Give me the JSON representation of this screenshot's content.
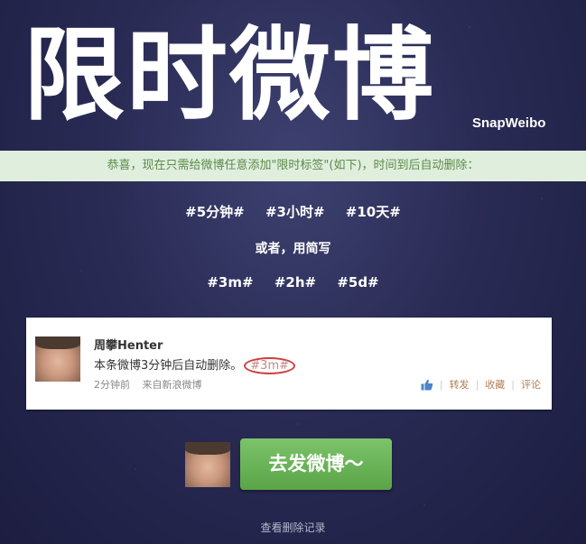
{
  "header": {
    "title": "限时微博",
    "brand": "SnapWeibo"
  },
  "notice": {
    "text": "恭喜，现在只需给微博任意添加\"限时标签\"(如下)，时间到后自动删除："
  },
  "tags_full": [
    "#5分钟#",
    "#3小时#",
    "#10天#"
  ],
  "or_text": "或者，用简写",
  "tags_abbr": [
    "#3m#",
    "#2h#",
    "#5d#"
  ],
  "example_post": {
    "username": "周攀Henter",
    "content": "本条微博3分钟后自动删除。",
    "tag": "#3m#",
    "time": "2分钟前",
    "source": "来自新浪微博",
    "actions": {
      "like_icon": "thumbs-up-icon",
      "repost": "转发",
      "favorite": "收藏",
      "comment": "评论"
    }
  },
  "cta": {
    "button_label": "去发微博～"
  },
  "footer": {
    "history_link": "查看删除记录"
  }
}
